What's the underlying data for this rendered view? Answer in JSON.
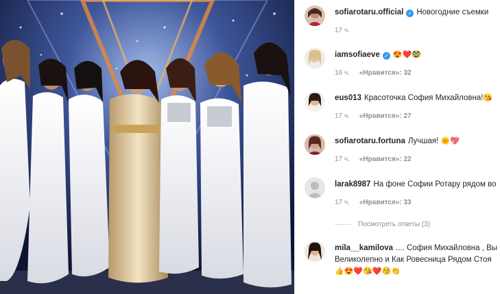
{
  "post": {
    "author": "sofiarotaru.official",
    "caption": "Новогодние съемки",
    "time": "17 ч."
  },
  "comments": [
    {
      "user": "iamsofiaeve",
      "verified": true,
      "text": "",
      "emojis": "😍❤️🥸",
      "time": "16 ч.",
      "likes": "«Нравится»: 32"
    },
    {
      "user": "eus013",
      "verified": false,
      "text": "Красоточка София Михайловна!",
      "emojis": "😘",
      "time": "17 ч.",
      "likes": "«Нравится»: 27"
    },
    {
      "user": "sofiarotaru.fortuna",
      "verified": false,
      "text": "Лучшая!",
      "emojis": "🌞💖",
      "time": "17 ч.",
      "likes": "«Нравится»: 22"
    },
    {
      "user": "larak8987",
      "verified": false,
      "text": "На фоне Софии Ротару рядом во",
      "emojis": "",
      "time": "17 ч.",
      "likes": "«Нравится»: 33"
    },
    {
      "user": "mila__kamilova",
      "verified": false,
      "text": ".... София Михайловна , Вы",
      "line2": "Великолепно и Как Ровесница Рядом Стоя",
      "emojis": "👍😍❤️😘❤️😚👏",
      "time": "",
      "likes": ""
    }
  ],
  "view_replies": "Посмотреть ответы (3)",
  "icons": {
    "verified": "verified-badge-icon",
    "avatar_placeholder": "default-avatar-icon"
  },
  "colors": {
    "link_blue": "#3897f0",
    "meta_gray": "#8e8e8e",
    "text": "#262626"
  }
}
